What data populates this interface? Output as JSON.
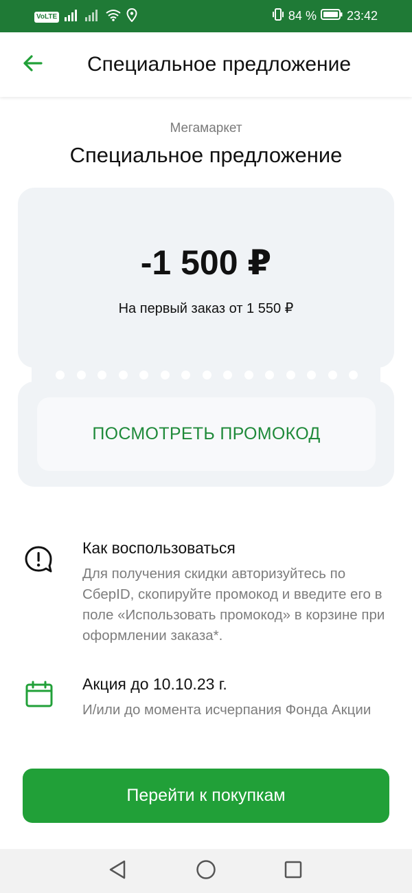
{
  "status_bar": {
    "volte": "VoLTE",
    "battery": "84 %",
    "time": "23:42"
  },
  "appbar": {
    "title": "Специальное предложение",
    "back_icon": "arrow-left-icon"
  },
  "offer": {
    "brand": "Мегамаркет",
    "title": "Специальное предложение",
    "amount": "-1 500 ₽",
    "condition": "На первый заказ от 1 550 ₽",
    "promo_button": "ПОСМОТРЕТЬ ПРОМОКОД"
  },
  "how_to": {
    "icon": "alert-bubble-icon",
    "title": "Как воспользоваться",
    "body": "Для получения скидки авторизуйтесь по СберID, скопируйте промокод и введите его в поле «Использовать промокод» в корзине при оформлении заказа*."
  },
  "validity": {
    "icon": "calendar-icon",
    "title": "Акция до 10.10.23 г.",
    "body": "И/или до момента исчерпания Фонда Акции"
  },
  "cta": {
    "label": "Перейти к покупкам"
  },
  "colors": {
    "brand_green": "#21a038",
    "status_green": "#1f7a36",
    "card_bg": "#f0f3f6"
  }
}
